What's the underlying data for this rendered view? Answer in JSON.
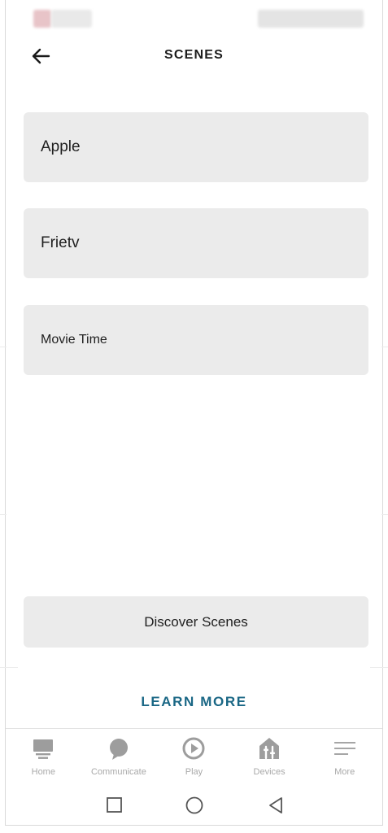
{
  "header": {
    "title": "SCENES",
    "back_icon": "arrow-left-icon"
  },
  "scenes": [
    {
      "label": "Apple"
    },
    {
      "label": "Frietv"
    },
    {
      "label": "Movie Time"
    }
  ],
  "discover_label": "Discover Scenes",
  "learn_more_label": "LEARN MORE",
  "tabs": [
    {
      "label": "Home",
      "icon": "home-icon"
    },
    {
      "label": "Communicate",
      "icon": "chat-bubble-icon"
    },
    {
      "label": "Play",
      "icon": "play-icon"
    },
    {
      "label": "Devices",
      "icon": "devices-icon"
    },
    {
      "label": "More",
      "icon": "menu-icon"
    }
  ],
  "colors": {
    "accent": "#1a6785",
    "card": "#ebebeb",
    "tab_inactive": "#a9a9a9"
  }
}
